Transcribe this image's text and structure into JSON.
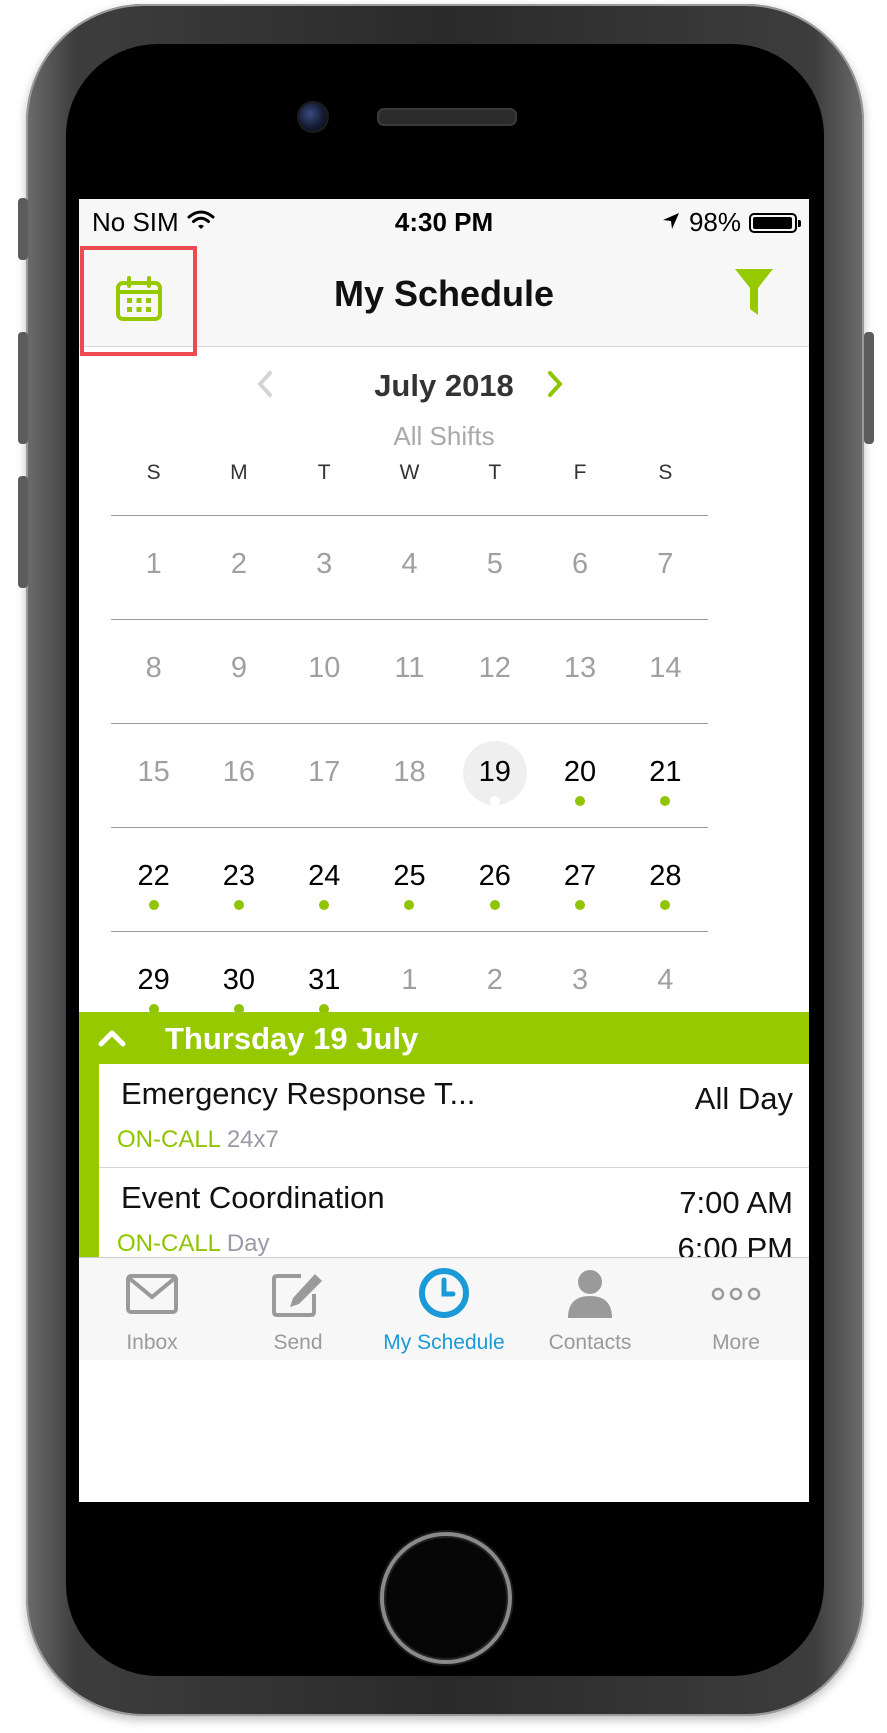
{
  "status_bar": {
    "carrier": "No SIM",
    "time": "4:30 PM",
    "battery": "98%",
    "battery_level": 0.98
  },
  "nav": {
    "title": "My Schedule"
  },
  "calendar": {
    "month": "July 2018",
    "filter": "All Shifts",
    "weekdays": [
      "S",
      "M",
      "T",
      "W",
      "T",
      "F",
      "S"
    ],
    "weeks": [
      [
        {
          "n": "1"
        },
        {
          "n": "2"
        },
        {
          "n": "3"
        },
        {
          "n": "4"
        },
        {
          "n": "5"
        },
        {
          "n": "6"
        },
        {
          "n": "7"
        }
      ],
      [
        {
          "n": "8"
        },
        {
          "n": "9"
        },
        {
          "n": "10"
        },
        {
          "n": "11"
        },
        {
          "n": "12"
        },
        {
          "n": "13"
        },
        {
          "n": "14"
        }
      ],
      [
        {
          "n": "15"
        },
        {
          "n": "16"
        },
        {
          "n": "17"
        },
        {
          "n": "18"
        },
        {
          "n": "19",
          "today": true,
          "shift": true
        },
        {
          "n": "20",
          "shift": true
        },
        {
          "n": "21",
          "shift": true
        }
      ],
      [
        {
          "n": "22",
          "shift": true
        },
        {
          "n": "23",
          "shift": true
        },
        {
          "n": "24",
          "shift": true
        },
        {
          "n": "25",
          "shift": true
        },
        {
          "n": "26",
          "shift": true
        },
        {
          "n": "27",
          "shift": true
        },
        {
          "n": "28",
          "shift": true
        }
      ],
      [
        {
          "n": "29",
          "shift": true
        },
        {
          "n": "30",
          "shift": true
        },
        {
          "n": "31",
          "shift": true
        },
        {
          "n": "1"
        },
        {
          "n": "2"
        },
        {
          "n": "3"
        },
        {
          "n": "4"
        }
      ]
    ]
  },
  "day_section": {
    "header": "Thursday 19 July",
    "events": [
      {
        "name": "Emergency Response T...",
        "time_start": "All Day",
        "time_end": "",
        "type": "ON-CALL",
        "detail": "24x7"
      },
      {
        "name": "Event Coordination",
        "time_start": "7:00 AM",
        "time_end": "6:00 PM",
        "type": "ON-CALL",
        "detail": "Day"
      }
    ]
  },
  "tabs": [
    {
      "label": "Inbox",
      "icon": "envelope-icon"
    },
    {
      "label": "Send",
      "icon": "compose-icon"
    },
    {
      "label": "My Schedule",
      "icon": "clock-icon",
      "active": true
    },
    {
      "label": "Contacts",
      "icon": "person-icon"
    },
    {
      "label": "More",
      "icon": "ellipsis-icon"
    }
  ],
  "colors": {
    "accent_green": "#97c900",
    "active_blue": "#1a9ad6",
    "highlight_red": "#ec4b4f"
  }
}
